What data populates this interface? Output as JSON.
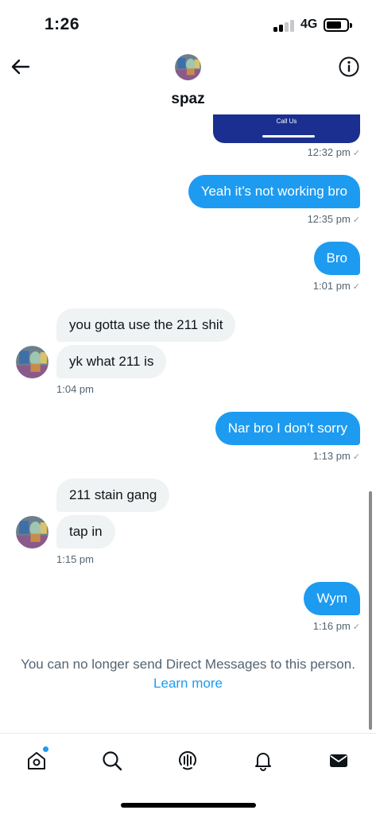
{
  "status_bar": {
    "time": "1:26",
    "network": "4G"
  },
  "header": {
    "contact_name": "spaz"
  },
  "card": {
    "label": "Call Us",
    "timestamp": "12:32 pm"
  },
  "messages": [
    {
      "side": "sent",
      "text": "Yeah it’s not working bro",
      "timestamp": "12:35 pm"
    },
    {
      "side": "sent",
      "text": "Bro",
      "timestamp": "1:01 pm"
    },
    {
      "side": "received",
      "text": "you gotta use the 211 shit"
    },
    {
      "side": "received",
      "text": "yk what 211 is",
      "timestamp": "1:04 pm"
    },
    {
      "side": "sent",
      "text": "Nar bro I don’t sorry",
      "timestamp": "1:13 pm"
    },
    {
      "side": "received",
      "text": "211 stain gang"
    },
    {
      "side": "received",
      "text": "tap in",
      "timestamp": "1:15 pm"
    },
    {
      "side": "sent",
      "text": "Wym",
      "timestamp": "1:16 pm"
    }
  ],
  "read_mark": "✓",
  "notice": {
    "text": "You can no longer send Direct Messages to this person.",
    "link": "Learn more"
  },
  "tabbar": {
    "items": [
      "home-icon",
      "search-icon",
      "spaces-icon",
      "notifications-icon",
      "messages-icon"
    ],
    "home_has_new": true
  },
  "colors": {
    "accent": "#1d9bf0",
    "received_bubble": "#eff3f4",
    "card": "#1a2f8f",
    "muted": "#536471"
  }
}
